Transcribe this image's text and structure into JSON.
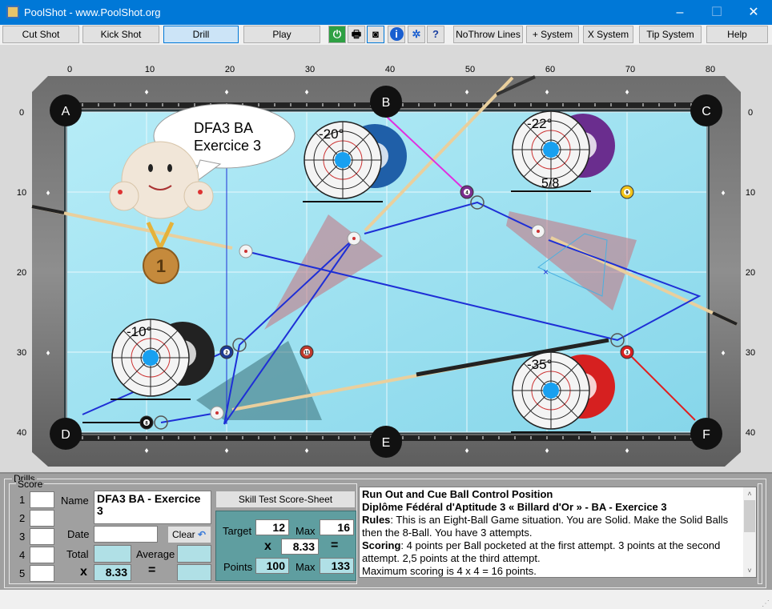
{
  "window": {
    "title": "PoolShot - www.PoolShot.org",
    "minimize": "–",
    "maximize": "☐",
    "close": "✕"
  },
  "toolbar": {
    "buttons": [
      {
        "label": "Cut Shot",
        "selected": false
      },
      {
        "label": "Kick Shot",
        "selected": false
      },
      {
        "label": "Drill",
        "selected": true
      },
      {
        "label": "Play",
        "selected": false
      },
      {
        "label": "NoThrow Lines"
      },
      {
        "label": "+ System"
      },
      {
        "label": "X System"
      },
      {
        "label": "Tip System"
      },
      {
        "label": "Help"
      }
    ],
    "icons": [
      "power-icon",
      "print-icon",
      "camera-icon",
      "info-icon",
      "settings-icon",
      "help-document-icon"
    ]
  },
  "table": {
    "x_ticks": [
      "0",
      "10",
      "20",
      "30",
      "40",
      "50",
      "60",
      "70",
      "80"
    ],
    "y_ticks": [
      "0",
      "10",
      "20",
      "30",
      "40"
    ],
    "pockets": [
      "A",
      "B",
      "C",
      "D",
      "E",
      "F"
    ],
    "bubble": "DFA3 BA\nExercice 3",
    "medal": "1",
    "balls": [
      {
        "n": "4",
        "x": 50,
        "y": 10,
        "color": "#7b2d8e"
      },
      {
        "n": "9",
        "x": 70,
        "y": 10,
        "color": "#f2c318"
      },
      {
        "n": "11",
        "x": 30,
        "y": 30,
        "color": "#c0392b"
      },
      {
        "n": "2",
        "x": 20,
        "y": 30,
        "color": "#1f3a93"
      },
      {
        "n": "3",
        "x": 70,
        "y": 30,
        "color": "#d62020"
      },
      {
        "n": "8",
        "x": 10,
        "y": 38.8,
        "color": "#111111"
      }
    ],
    "cue_balls": [
      {
        "x": 22.4,
        "y": 17.4
      },
      {
        "x": 35.9,
        "y": 15.8
      },
      {
        "x": 58.9,
        "y": 14.9
      },
      {
        "x": 18.8,
        "y": 37.6
      }
    ],
    "spin_diagrams": [
      {
        "angle": "-20°",
        "ball": "2",
        "color": "#1f5fa8",
        "x": 34,
        "y": 6
      },
      {
        "angle": "-22°",
        "ball": "4",
        "color": "#6a2d8e",
        "x": 60,
        "y": 4.7,
        "fraction": "5/8"
      },
      {
        "angle": "-10°",
        "ball": "8",
        "color": "#222222",
        "x": 10,
        "y": 30.7
      },
      {
        "angle": "-35°",
        "ball": "3",
        "color": "#d62020",
        "x": 60,
        "y": 34.8
      }
    ]
  },
  "drills": {
    "group": "Drills",
    "score_group": "Score",
    "rows": [
      "1",
      "2",
      "3",
      "4",
      "5"
    ],
    "name_label": "Name",
    "name_value": "DFA3 BA - Exercice 3",
    "date_label": "Date",
    "date_value": "",
    "clear": "Clear",
    "total_label": "Total",
    "average_label": "Average",
    "x_label": "x",
    "x_value": "8.33",
    "eq": "=",
    "sheet_button": "Skill Test Score-Sheet",
    "target_label": "Target",
    "target": "12",
    "max_label": "Max",
    "max": "16",
    "mult": "8.33",
    "points_label": "Points",
    "points": "100",
    "points_max": "133"
  },
  "description": {
    "title": "Run Out and Cue Ball Control Position",
    "subtitle": "Diplôme Fédéral d'Aptitude 3 « Billard d'Or » - BA - Exercice 3",
    "rules_label": "Rules",
    "rules": ": This is an Eight-Ball Game situation. You are Solid. Make the Solid Balls then the 8-Ball. You have 3 attempts.",
    "scoring_label": "Scoring",
    "scoring": ": 4 points per Ball pocketed at the first attempt. 3 points at the second attempt. 2,5 points at the third attempt.",
    "max_line": "Maximum scoring is 4 x 4 = 16 points."
  }
}
